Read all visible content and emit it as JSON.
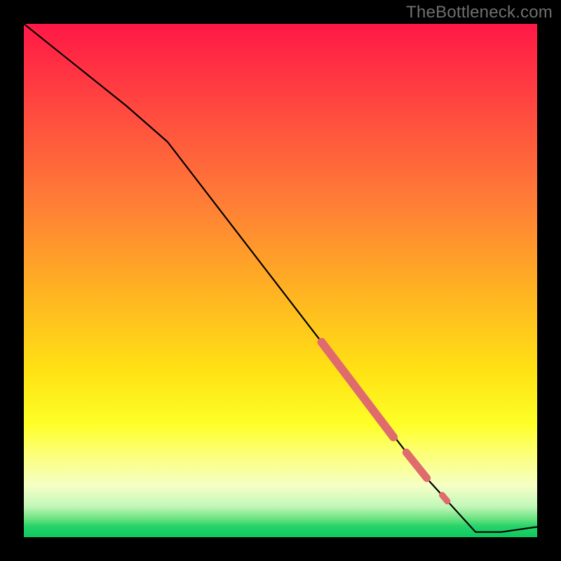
{
  "watermark": "TheBottleneck.com",
  "chart_data": {
    "type": "line",
    "title": "",
    "xlabel": "",
    "ylabel": "",
    "xlim": [
      0,
      100
    ],
    "ylim": [
      0,
      100
    ],
    "background_gradient": {
      "stops": [
        {
          "offset": 0.0,
          "color": "#ff1846"
        },
        {
          "offset": 0.18,
          "color": "#ff4d3f"
        },
        {
          "offset": 0.35,
          "color": "#ff7e36"
        },
        {
          "offset": 0.52,
          "color": "#ffb222"
        },
        {
          "offset": 0.68,
          "color": "#ffe314"
        },
        {
          "offset": 0.78,
          "color": "#feff27"
        },
        {
          "offset": 0.84,
          "color": "#fcff7a"
        },
        {
          "offset": 0.9,
          "color": "#f5ffc5"
        },
        {
          "offset": 0.94,
          "color": "#c3f7ba"
        },
        {
          "offset": 0.965,
          "color": "#67e27f"
        },
        {
          "offset": 0.978,
          "color": "#29d36b"
        },
        {
          "offset": 1.0,
          "color": "#0bc95f"
        }
      ]
    },
    "series": [
      {
        "name": "curve",
        "x": [
          0,
          10,
          20,
          28,
          38,
          48,
          58,
          68,
          78,
          88,
          93,
          100
        ],
        "y": [
          100,
          92,
          84,
          77,
          64,
          51,
          38,
          25,
          12,
          1,
          1,
          2
        ],
        "stroke": "#000000",
        "stroke_width": 2.2
      }
    ],
    "highlights": [
      {
        "name": "segment-main",
        "x": [
          58,
          72
        ],
        "y": [
          38,
          19.5
        ],
        "stroke": "#df6b6c",
        "stroke_width": 12,
        "cap": "round"
      },
      {
        "name": "dot-a",
        "x": [
          74.5,
          78.5
        ],
        "y": [
          16.5,
          11.5
        ],
        "stroke": "#df6b6c",
        "stroke_width": 11,
        "cap": "round"
      },
      {
        "name": "dot-b",
        "x": [
          81.5,
          82.5
        ],
        "y": [
          8.2,
          7.0
        ],
        "stroke": "#df6b6c",
        "stroke_width": 9,
        "cap": "round"
      }
    ]
  }
}
